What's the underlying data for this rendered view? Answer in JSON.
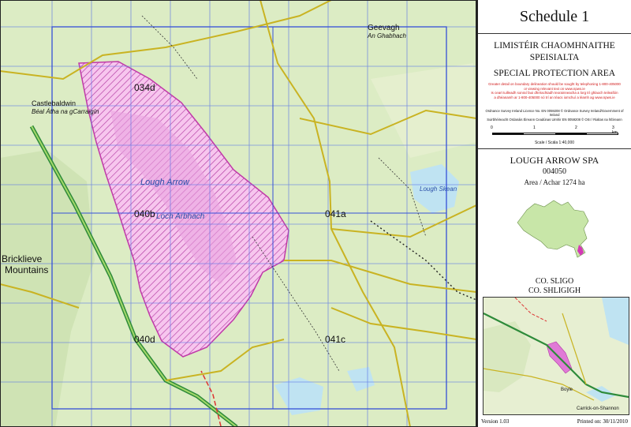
{
  "panel": {
    "schedule": "Schedule 1",
    "irish_title_1": "LIMISTÉIR CHAOMHNAITHE",
    "irish_title_2": "SPEISIALTA",
    "english_title": "SPECIAL PROTECTION AREA",
    "notice_lines": [
      "Greater detail on boundary delineation should be sought by telephoning 1-800-405000",
      "or viewing relevant text on www.npws.ie",
      "Is ceart tuilleadh sonraí faoi dhréachtadh teorainneacha a lorg trí ghlaoch teileafóin",
      "a dhéanamh ar 1-800-405000 nó trí an téacs iomchuí a léamh ag www.npws.ie"
    ],
    "licence_lines": [
      "Ordnance Survey Ireland Licence No. EN 0059208 © Ordnance Survey Ireland/Government of Ireland",
      "Suirbhéireacht Ordanáis Éireann Ceadúnas Uimhir EN 0059208 © OSI / Rialtas na hÉireann"
    ],
    "scale_ticks": [
      "0",
      "1",
      "2",
      "3 km"
    ],
    "scale_text": "Scale / Scála 1:40,000",
    "site_name": "LOUGH ARROW SPA",
    "site_code": "004050",
    "area_text": "Area / Achar 1274 ha",
    "county_en": "CO. SLIGO",
    "county_ga": "CO. SHLIGIGH",
    "version": "Version 1.03",
    "printed": "Printed on: 30/11/2010"
  },
  "map": {
    "sheets": [
      "034d",
      "040b",
      "041a",
      "040d",
      "041c"
    ],
    "labels": {
      "lough_arrow": "Lough Arrow",
      "loch_arbhach": "Loch Arbhach",
      "bricklieve_1": "Bricklieve",
      "bricklieve_2": "Mountains",
      "carrigan_1": "Castlebaldwin",
      "carrigan_2": "Béal Átha na gCarraigín",
      "geevagh": "Geevagh",
      "geevagh_ga": "An Ghabhach",
      "skean": "Lough Skean"
    }
  },
  "inset": {
    "boyle": "Boyle",
    "carrick": "Carrick-on-Shannon"
  },
  "colors": {
    "land": "#dcecc4",
    "water": "#bfe3f2",
    "spa_fill": "#f5b6ec",
    "spa_hatch": "#b03aa0",
    "grid": "#4a64e0",
    "road_main": "#2e8b3a",
    "road_minor": "#e6d63a"
  }
}
